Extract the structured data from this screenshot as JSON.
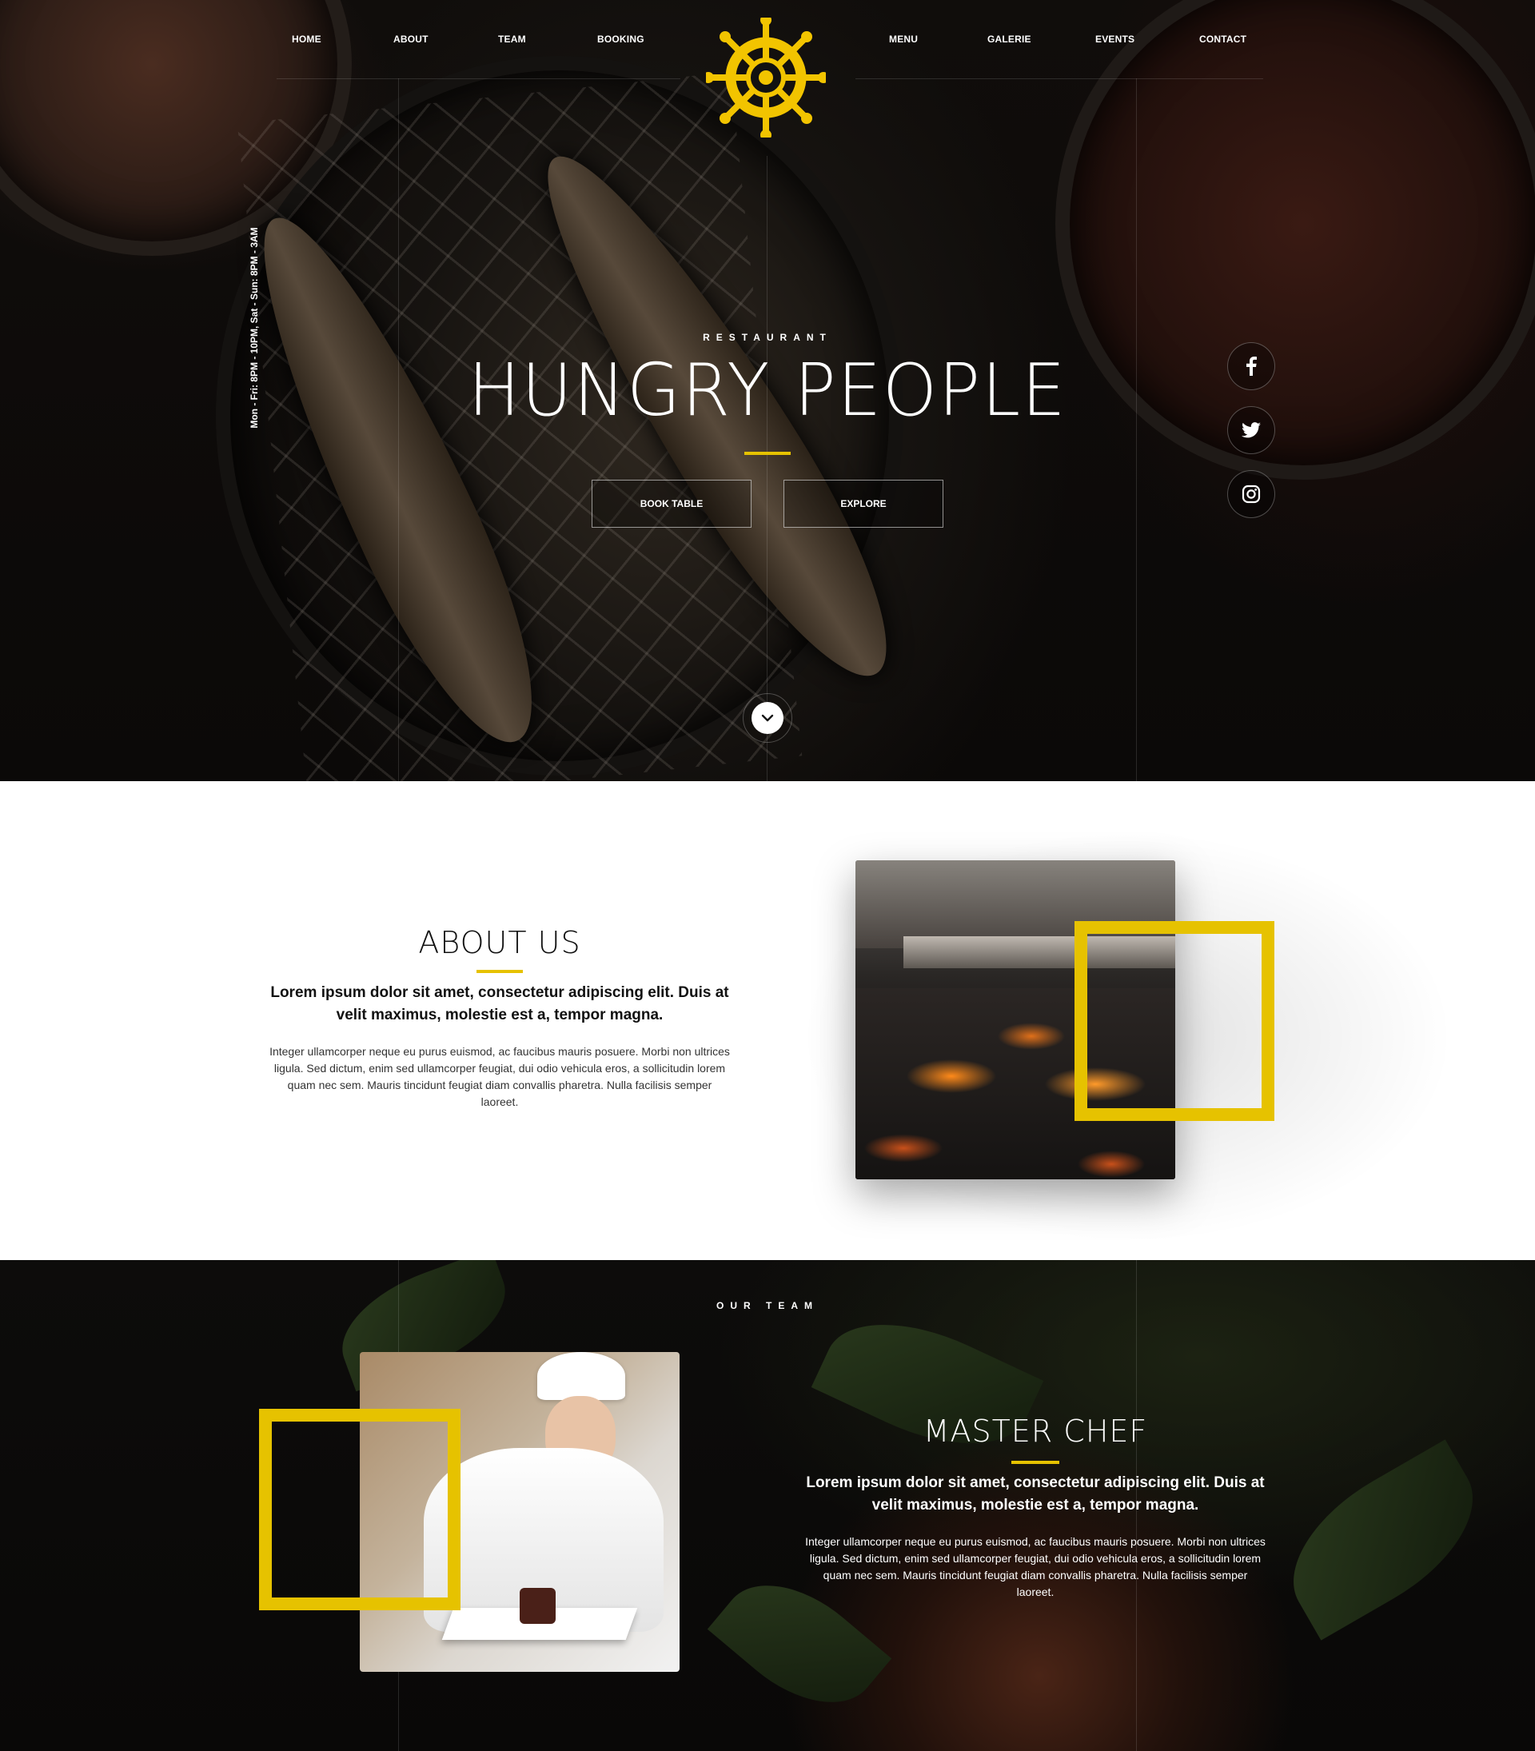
{
  "nav": {
    "left": [
      "HOME",
      "ABOUT",
      "TEAM",
      "BOOKING"
    ],
    "right": [
      "MENU",
      "GALERIE",
      "EVENTS",
      "CONTACT"
    ]
  },
  "hero": {
    "tagline": "RESTAURANT",
    "title": "HUNGRY PEOPLE",
    "book_label": "BOOK TABLE",
    "explore_label": "EXPLORE",
    "hours": "Mon - Fri: 8PM - 10PM, Sat - Sun: 8PM - 3AM",
    "social": [
      "facebook-icon",
      "twitter-icon",
      "instagram-icon"
    ]
  },
  "about": {
    "title": "ABOUT US",
    "lead": "Lorem ipsum dolor sit amet, consectetur adipiscing elit. Duis at velit maximus, molestie est a, tempor magna.",
    "body": "Integer ullamcorper neque eu purus euismod, ac faucibus mauris posuere. Morbi non ultrices ligula. Sed dictum, enim sed ullamcorper feugiat, dui odio vehicula eros, a sollicitudin lorem quam nec sem. Mauris tincidunt feugiat diam convallis pharetra. Nulla facilisis semper laoreet."
  },
  "team": {
    "tag": "OUR TEAM",
    "title": "MASTER CHEF",
    "lead": "Lorem ipsum dolor sit amet, consectetur adipiscing elit. Duis at velit maximus, molestie est a, tempor magna.",
    "body": "Integer ullamcorper neque eu purus euismod, ac faucibus mauris posuere. Morbi non ultrices ligula. Sed dictum, enim sed ullamcorper feugiat, dui odio vehicula eros, a sollicitudin lorem quam nec sem. Mauris tincidunt feugiat diam convallis pharetra. Nulla facilisis semper laoreet."
  },
  "colors": {
    "accent": "#e6c200",
    "dark": "#0b0908",
    "light": "#ffffff"
  }
}
